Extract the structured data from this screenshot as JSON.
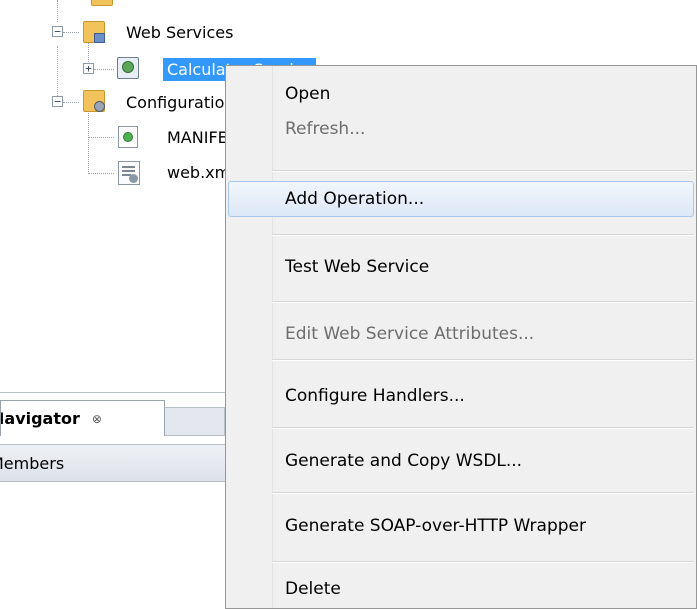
{
  "tree": {
    "items": [
      {
        "label": "Web Services"
      },
      {
        "label": "Calculator Service"
      },
      {
        "label": "Configuration Files"
      },
      {
        "label": "MANIFEST.MF"
      },
      {
        "label": "web.xml"
      }
    ],
    "expander_plus": "+",
    "expander_minus": "−"
  },
  "navigator": {
    "title": "Navigator",
    "close_glyph": "⊗",
    "filter_label": "Members"
  },
  "context_menu": {
    "items": [
      {
        "label": "Open"
      },
      {
        "label": "Refresh..."
      },
      {
        "label": "Add Operation..."
      },
      {
        "label": "Test Web Service"
      },
      {
        "label": "Edit Web Service Attributes..."
      },
      {
        "label": "Configure Handlers..."
      },
      {
        "label": "Generate and Copy WSDL..."
      },
      {
        "label": "Generate SOAP-over-HTTP Wrapper"
      },
      {
        "label": "Delete"
      }
    ]
  },
  "colors": {
    "selection": "#3399ff",
    "menu_background": "#f0f0f0",
    "hover_border": "#a8c8eb",
    "disabled_text": "#6d6d6d"
  },
  "icons": {
    "folder": "folder-icon",
    "web_service": "web-service-icon",
    "manifest": "manifest-file-icon",
    "xml_file": "xml-file-icon"
  }
}
